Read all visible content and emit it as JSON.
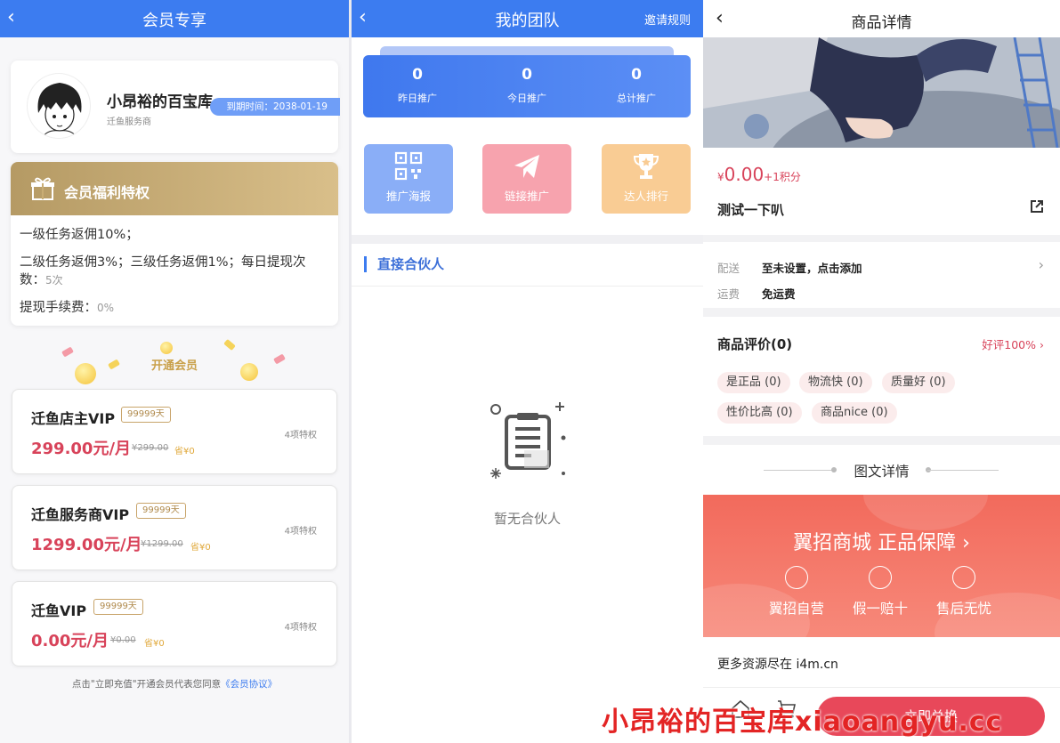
{
  "member": {
    "title": "会员专享",
    "profile": {
      "name": "小昂裕的百宝库",
      "role": "迁鱼服务商",
      "expire": "到期时间：2038-01-19"
    },
    "benefits": {
      "title": "会员福利特权",
      "line1": "一级任务返佣10%；",
      "line2": "二级任务返佣3%；三级任务返佣1%；每日提现次数：",
      "line2_value": "5次",
      "line3": "提现手续费：",
      "line3_value": "0%"
    },
    "open_label": "开通会员",
    "plans": [
      {
        "name": "迁鱼店主VIP",
        "days": "99999天",
        "price": "299.00元/月",
        "old": "¥299.00",
        "save": "省¥0",
        "count": "4项特权"
      },
      {
        "name": "迁鱼服务商VIP",
        "days": "99999天",
        "price": "1299.00元/月",
        "old": "¥1299.00",
        "save": "省¥0",
        "count": "4项特权"
      },
      {
        "name": "迁鱼VIP",
        "days": "99999天",
        "price": "0.00元/月",
        "old": "¥0.00",
        "save": "省¥0",
        "count": "4项特权"
      }
    ],
    "agree_prefix": "点击\"立即充值\"开通会员代表您同意",
    "agree_link": "《会员协议》"
  },
  "team": {
    "title": "我的团队",
    "right_action": "邀请规则",
    "stats": [
      {
        "value": "0",
        "label": "昨日推广"
      },
      {
        "value": "0",
        "label": "今日推广"
      },
      {
        "value": "0",
        "label": "总计推广"
      }
    ],
    "tiles": [
      {
        "label": "推广海报",
        "icon": "qrcode-icon",
        "color": "#8aaef7"
      },
      {
        "label": "链接推广",
        "icon": "paper-plane-icon",
        "color": "#f7a3ae"
      },
      {
        "label": "达人排行",
        "icon": "trophy-icon",
        "color": "#f9cc94"
      }
    ],
    "section_title": "直接合伙人",
    "empty_text": "暂无合伙人"
  },
  "goods": {
    "title": "商品详情",
    "price_symbol": "¥",
    "price": "0.00",
    "points": "+1积分",
    "name": "测试一下叭",
    "delivery_label": "配送",
    "delivery_value": "至未设置，点击添加",
    "freight_label": "运费",
    "freight_value": "免运费",
    "review_title": "商品评价(0)",
    "review_rate": "好评100%",
    "tags": [
      "是正品 (0)",
      "物流快 (0)",
      "质量好 (0)",
      "性价比高 (0)",
      "商品nice (0)"
    ],
    "detail_title": "图文详情",
    "banner_title": "翼招商城 正品保障",
    "features": [
      "翼招自营",
      "假一赔十",
      "售后无忧"
    ],
    "more_text": "更多资源尽在 i4m.cn",
    "buy_label": "立即兑换"
  },
  "watermark": "小昂裕的百宝库xiaoangyu.cc",
  "colors": {
    "primary_blue": "#3c7cf0",
    "gold": "#c9a04a",
    "price_red": "#d8435a"
  }
}
